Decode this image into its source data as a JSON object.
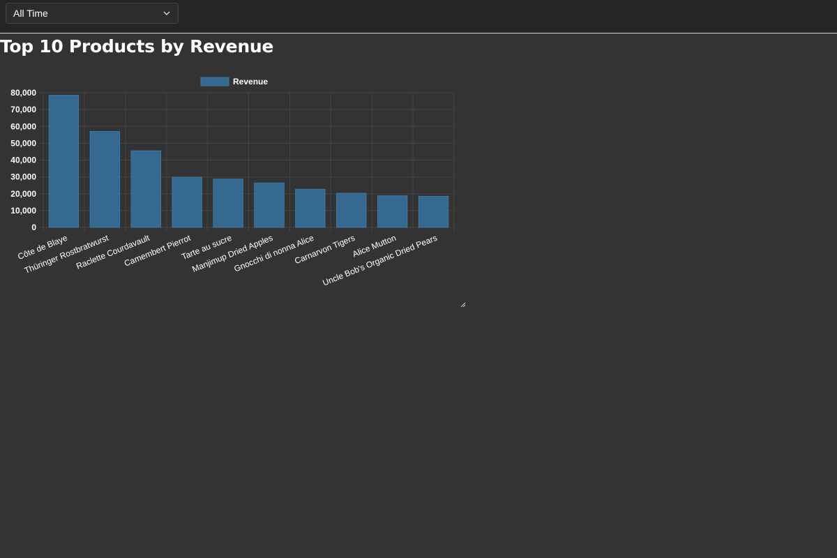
{
  "filter": {
    "selected": "All Time",
    "icon": "chevron-down-icon"
  },
  "page": {
    "title": "Top 10 Products by Revenue"
  },
  "colors": {
    "bar_fill": "#36698f",
    "bar_stroke": "#3d78a4",
    "grid": "#444444",
    "text": "#ffffff",
    "background": "#333333"
  },
  "chart_data": {
    "type": "bar",
    "categories": [
      "Côte de Blaye",
      "Thüringer Rostbratwurst",
      "Raclette Courdavault",
      "Camembert Pierrot",
      "Tarte au sucre",
      "Manjimup Dried Apples",
      "Gnocchi di nonna Alice",
      "Carnarvon Tigers",
      "Alice Mutton",
      "Uncle Bob's Organic Dried Pears"
    ],
    "series": [
      {
        "name": "Revenue",
        "values": [
          78500,
          57000,
          45500,
          29800,
          28700,
          26400,
          22700,
          20300,
          18800,
          18500
        ]
      }
    ],
    "y_ticks": [
      "0",
      "10,000",
      "20,000",
      "30,000",
      "40,000",
      "50,000",
      "60,000",
      "70,000",
      "80,000"
    ],
    "ylim": [
      0,
      80000
    ],
    "grid": true,
    "legend_position": "top-center"
  }
}
